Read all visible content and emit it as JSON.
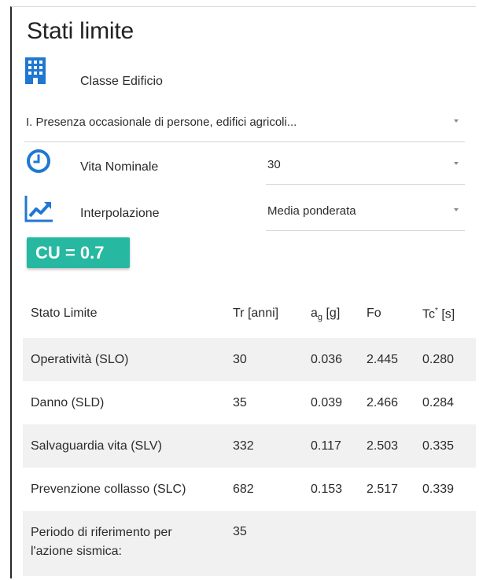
{
  "page": {
    "title": "Stati limite"
  },
  "classe": {
    "label": "Classe Edificio",
    "value": "I. Presenza occasionale di persone, edifici agricoli...",
    "icon": "building-icon"
  },
  "vita": {
    "label": "Vita Nominale",
    "value": "30",
    "icon": "clock-icon"
  },
  "interpolazione": {
    "label": "Interpolazione",
    "value": "Media ponderata",
    "icon": "trend-chart-icon"
  },
  "cu": {
    "text": "CU = 0.7"
  },
  "colors": {
    "accent_blue": "#1f78d1",
    "cu_badge": "#26b8a0"
  },
  "table": {
    "headers": {
      "stato": "Stato Limite",
      "tr": "Tr [anni]",
      "ag_main": "a",
      "ag_sub": "g",
      "ag_unit": " [g]",
      "fo": "Fo",
      "tc_main": "Tc",
      "tc_sup": "*",
      "tc_unit": " [s]"
    },
    "rows": [
      {
        "stato": "Operatività (SLO)",
        "tr": "30",
        "ag": "0.036",
        "fo": "2.445",
        "tc": "0.280"
      },
      {
        "stato": "Danno (SLD)",
        "tr": "35",
        "ag": "0.039",
        "fo": "2.466",
        "tc": "0.284"
      },
      {
        "stato": "Salvaguardia vita (SLV)",
        "tr": "332",
        "ag": "0.117",
        "fo": "2.503",
        "tc": "0.335"
      },
      {
        "stato": "Prevenzione collasso (SLC)",
        "tr": "682",
        "ag": "0.153",
        "fo": "2.517",
        "tc": "0.339"
      }
    ],
    "periodo": {
      "label": "Periodo di riferimento per l'azione sismica:",
      "value": "35"
    }
  }
}
